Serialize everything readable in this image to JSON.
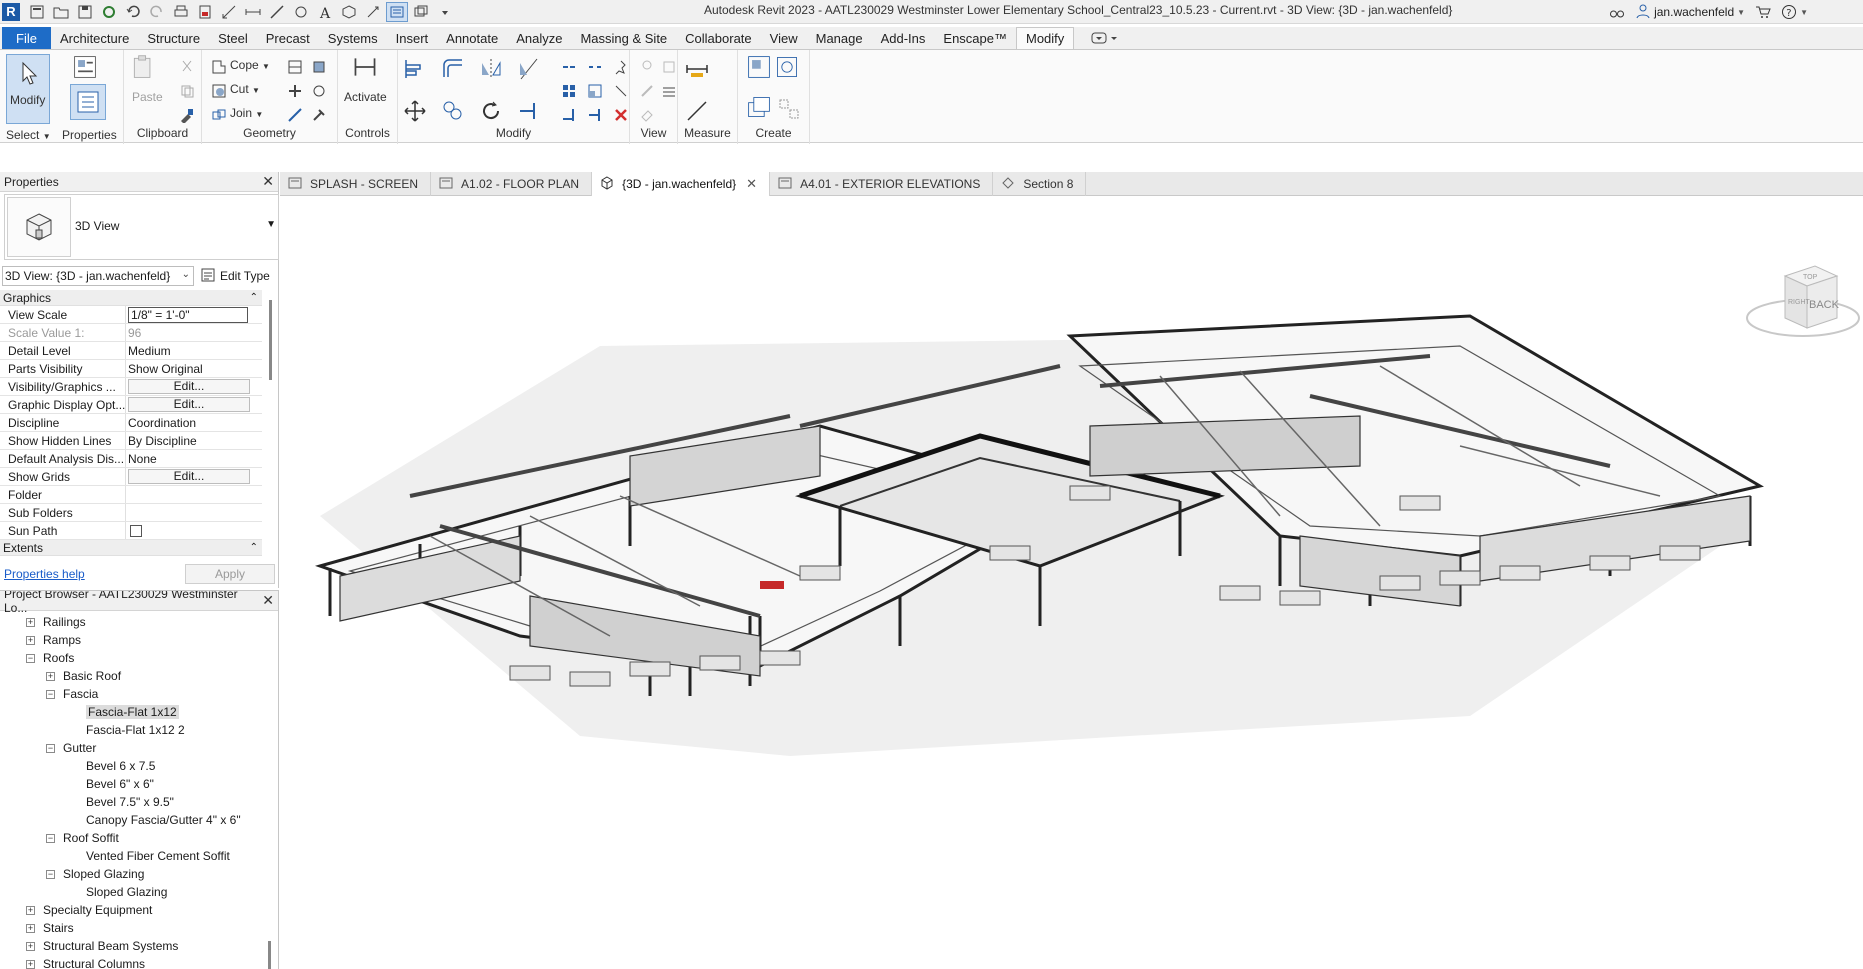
{
  "titlebar": {
    "app_logo": "R",
    "title": "Autodesk Revit 2023 - AATL230029 Westminster Lower Elementary School_Central23_10.5.23 - Current.rvt - 3D View: {3D - jan.wachenfeld}",
    "username": "jan.wachenfeld"
  },
  "menu": {
    "tabs": [
      "File",
      "Architecture",
      "Structure",
      "Steel",
      "Precast",
      "Systems",
      "Insert",
      "Annotate",
      "Analyze",
      "Massing & Site",
      "Collaborate",
      "View",
      "Manage",
      "Add-Ins",
      "Enscape™",
      "Modify"
    ],
    "active": "Modify"
  },
  "ribbon": {
    "select_group": {
      "modify_label": "Modify",
      "select_label": "Select",
      "properties_label": "Properties"
    },
    "clipboard": {
      "paste_label": "Paste",
      "group_label": "Clipboard"
    },
    "geometry": {
      "cope_label": "Cope",
      "cut_label": "Cut",
      "join_label": "Join",
      "group_label": "Geometry"
    },
    "controls": {
      "activate_label": "Activate",
      "group_label": "Controls"
    },
    "modify": {
      "group_label": "Modify"
    },
    "view": {
      "group_label": "View"
    },
    "measure": {
      "group_label": "Measure"
    },
    "create": {
      "group_label": "Create"
    }
  },
  "view_tabs": [
    {
      "label": "SPLASH - SCREEN",
      "icon": "sheet-icon",
      "active": false
    },
    {
      "label": "A1.02 - FLOOR PLAN",
      "icon": "sheet-icon",
      "active": false
    },
    {
      "label": "{3D - jan.wachenfeld}",
      "icon": "3d-view-icon",
      "active": true
    },
    {
      "label": "A4.01 - EXTERIOR ELEVATIONS",
      "icon": "sheet-icon",
      "active": false
    },
    {
      "label": "Section 8",
      "icon": "section-icon",
      "active": false
    }
  ],
  "properties": {
    "header": "Properties",
    "type_name": "3D View",
    "instance": "3D View: {3D - jan.wachenfeld}",
    "edit_type": "Edit Type",
    "category_graphics": "Graphics",
    "category_extents": "Extents",
    "rows": [
      {
        "name": "View Scale",
        "value": "1/8\" = 1'-0\""
      },
      {
        "name": "Scale Value    1:",
        "value": "96"
      },
      {
        "name": "Detail Level",
        "value": "Medium"
      },
      {
        "name": "Parts Visibility",
        "value": "Show Original"
      },
      {
        "name": "Visibility/Graphics ...",
        "value": "Edit..."
      },
      {
        "name": "Graphic Display Opt...",
        "value": "Edit..."
      },
      {
        "name": "Discipline",
        "value": "Coordination"
      },
      {
        "name": "Show Hidden Lines",
        "value": "By Discipline"
      },
      {
        "name": "Default Analysis Dis...",
        "value": "None"
      },
      {
        "name": "Show Grids",
        "value": "Edit..."
      },
      {
        "name": "Folder",
        "value": ""
      },
      {
        "name": "Sub Folders",
        "value": ""
      },
      {
        "name": "Sun Path",
        "value": ""
      }
    ],
    "help_link": "Properties help",
    "apply": "Apply"
  },
  "browser": {
    "header": "Project Browser - AATL230029 Westminster Lo...",
    "items": [
      {
        "label": "Railings",
        "level": 1,
        "toggle": "+"
      },
      {
        "label": "Ramps",
        "level": 1,
        "toggle": "+"
      },
      {
        "label": "Roofs",
        "level": 1,
        "toggle": "−"
      },
      {
        "label": "Basic Roof",
        "level": 2,
        "toggle": "+"
      },
      {
        "label": "Fascia",
        "level": 2,
        "toggle": "−"
      },
      {
        "label": "Fascia-Flat 1x12",
        "level": 3,
        "toggle": "",
        "selected": true
      },
      {
        "label": "Fascia-Flat 1x12 2",
        "level": 3,
        "toggle": ""
      },
      {
        "label": "Gutter",
        "level": 2,
        "toggle": "−"
      },
      {
        "label": "Bevel 6 x 7.5",
        "level": 3,
        "toggle": ""
      },
      {
        "label": "Bevel 6\" x 6\"",
        "level": 3,
        "toggle": ""
      },
      {
        "label": "Bevel 7.5\" x 9.5\"",
        "level": 3,
        "toggle": ""
      },
      {
        "label": "Canopy Fascia/Gutter 4\" x 6\"",
        "level": 3,
        "toggle": ""
      },
      {
        "label": "Roof Soffit",
        "level": 2,
        "toggle": "−"
      },
      {
        "label": "Vented Fiber Cement Soffit",
        "level": 3,
        "toggle": ""
      },
      {
        "label": "Sloped Glazing",
        "level": 2,
        "toggle": "−"
      },
      {
        "label": "Sloped Glazing",
        "level": 3,
        "toggle": ""
      },
      {
        "label": "Specialty Equipment",
        "level": 1,
        "toggle": "+"
      },
      {
        "label": "Stairs",
        "level": 1,
        "toggle": "+"
      },
      {
        "label": "Structural Beam Systems",
        "level": 1,
        "toggle": "+"
      },
      {
        "label": "Structural Columns",
        "level": 1,
        "toggle": "+"
      }
    ]
  },
  "viewcube": {
    "face_label": "BACK",
    "side_label": "RIGHT",
    "top_label": "TOP"
  },
  "colors": {
    "accent": "#1e6cc7",
    "selected_bg": "#cfe0f3"
  }
}
